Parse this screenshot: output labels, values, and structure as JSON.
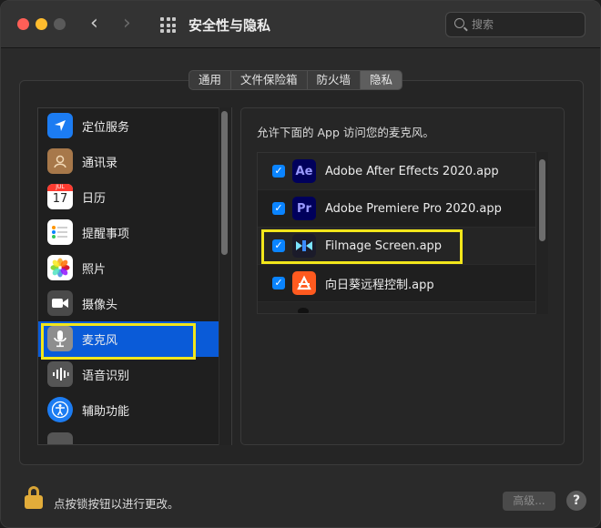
{
  "window": {
    "title": "安全性与隐私",
    "nav_back": "‹",
    "nav_forward": "›"
  },
  "search": {
    "placeholder": "搜索"
  },
  "tabs": [
    {
      "label": "通用",
      "active": false
    },
    {
      "label": "文件保险箱",
      "active": false
    },
    {
      "label": "防火墙",
      "active": false
    },
    {
      "label": "隐私",
      "active": true
    }
  ],
  "sidebar": {
    "items": [
      {
        "label": "定位服务",
        "icon": "location-arrow-icon",
        "icon_color": "#1c7cf2"
      },
      {
        "label": "通讯录",
        "icon": "contacts-icon",
        "icon_color": "#a7784a"
      },
      {
        "label": "日历",
        "icon": "calendar-icon",
        "icon_text": "17",
        "icon_month": "JUL"
      },
      {
        "label": "提醒事项",
        "icon": "reminders-icon",
        "icon_color": "#ffffff"
      },
      {
        "label": "照片",
        "icon": "photos-icon",
        "icon_color": "#ffffff"
      },
      {
        "label": "摄像头",
        "icon": "camera-icon",
        "icon_color": "#5a5a5a"
      },
      {
        "label": "麦克风",
        "icon": "microphone-icon",
        "icon_color": "#8a8a8a",
        "selected": true
      },
      {
        "label": "语音识别",
        "icon": "speech-recognition-icon",
        "icon_color": "#6a6a6a"
      },
      {
        "label": "辅助功能",
        "icon": "accessibility-icon",
        "icon_color": "#1c7cf2"
      }
    ]
  },
  "main": {
    "description": "允许下面的 App 访问您的麦克风。",
    "apps": [
      {
        "name": "Adobe After Effects 2020.app",
        "icon": "after-effects-icon",
        "icon_text": "Ae",
        "checked": true
      },
      {
        "name": "Adobe Premiere Pro 2020.app",
        "icon": "premiere-pro-icon",
        "icon_text": "Pr",
        "checked": true
      },
      {
        "name": "Filmage Screen.app",
        "icon": "filmage-screen-icon",
        "checked": true
      },
      {
        "name": "向日葵远程控制.app",
        "icon": "sunlogin-icon",
        "checked": true
      }
    ]
  },
  "footer": {
    "lock_text": "点按锁按钮以进行更改。",
    "advanced_label": "高级...",
    "help_label": "?"
  },
  "colors": {
    "accent": "#0a84ff",
    "selection": "#0a5bd8",
    "highlight": "#f2e61b"
  }
}
